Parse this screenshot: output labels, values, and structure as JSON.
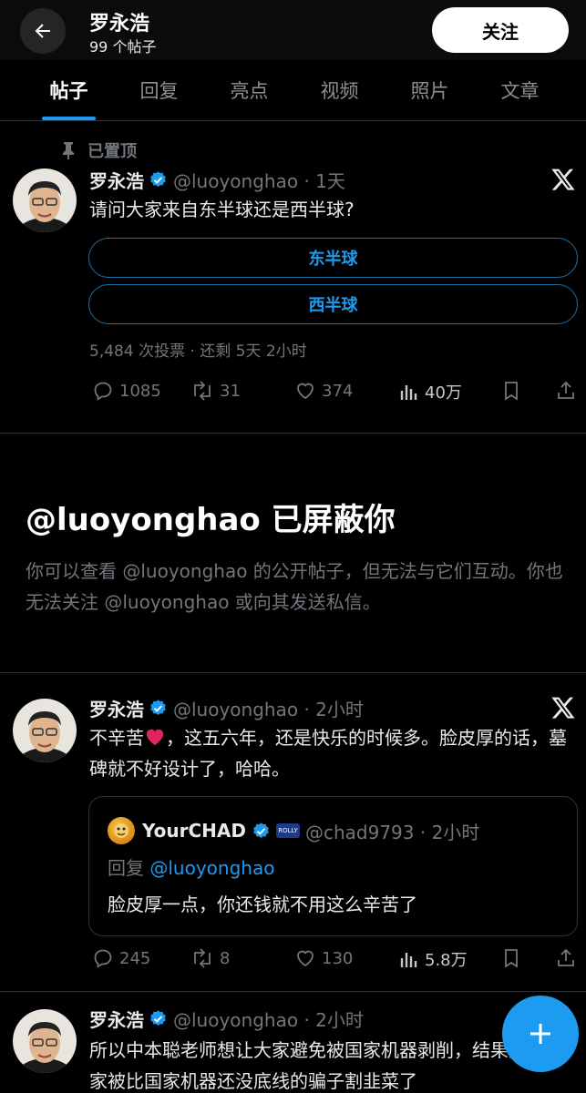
{
  "header": {
    "name": "罗永浩",
    "post_count": "99 个帖子",
    "follow_label": "关注"
  },
  "tabs": [
    {
      "label": "帖子",
      "active": true
    },
    {
      "label": "回复"
    },
    {
      "label": "亮点"
    },
    {
      "label": "视频"
    },
    {
      "label": "照片"
    },
    {
      "label": "文章"
    }
  ],
  "pinned_label": "已置顶",
  "posts": [
    {
      "name": "罗永浩",
      "handle": "@luoyonghao · 1天",
      "text": "请问大家来自东半球还是西半球?",
      "poll": {
        "options": [
          "东半球",
          "西半球"
        ],
        "meta": "5,484 次投票 · 还剩 5天 2小时"
      },
      "stats": {
        "replies": "1085",
        "reposts": "31",
        "likes": "374",
        "views": "40万"
      }
    },
    {
      "name": "罗永浩",
      "handle": "@luoyonghao · 2小时",
      "text_before_emoji": "不辛苦",
      "text_after_emoji": "，这五六年，还是快乐的时候多。脸皮厚的话，墓碑就不好设计了，哈哈。",
      "quote": {
        "name": "YourCHAD",
        "badge_text": "ROLLY",
        "handle": "@chad9793 · 2小时",
        "reply_prefix": "回复",
        "reply_handle": "@luoyonghao",
        "text": "脸皮厚一点，你还钱就不用这么辛苦了"
      },
      "stats": {
        "replies": "245",
        "reposts": "8",
        "likes": "130",
        "views": "5.8万"
      }
    },
    {
      "name": "罗永浩",
      "handle": "@luoyonghao · 2小时",
      "text": "所以中本聪老师想让大家避免被国家机器剥削，结果是让大家被比国家机器还没底线的骗子割韭菜了"
    }
  ],
  "blocked": {
    "title": "@luoyonghao 已屏蔽你",
    "description": "你可以查看 @luoyonghao 的公开帖子，但无法与它们互动。你也无法关注 @luoyonghao 或向其发送私信。"
  },
  "colors": {
    "accent": "#1d9bf0",
    "muted": "#71767b",
    "background": "#000000"
  }
}
